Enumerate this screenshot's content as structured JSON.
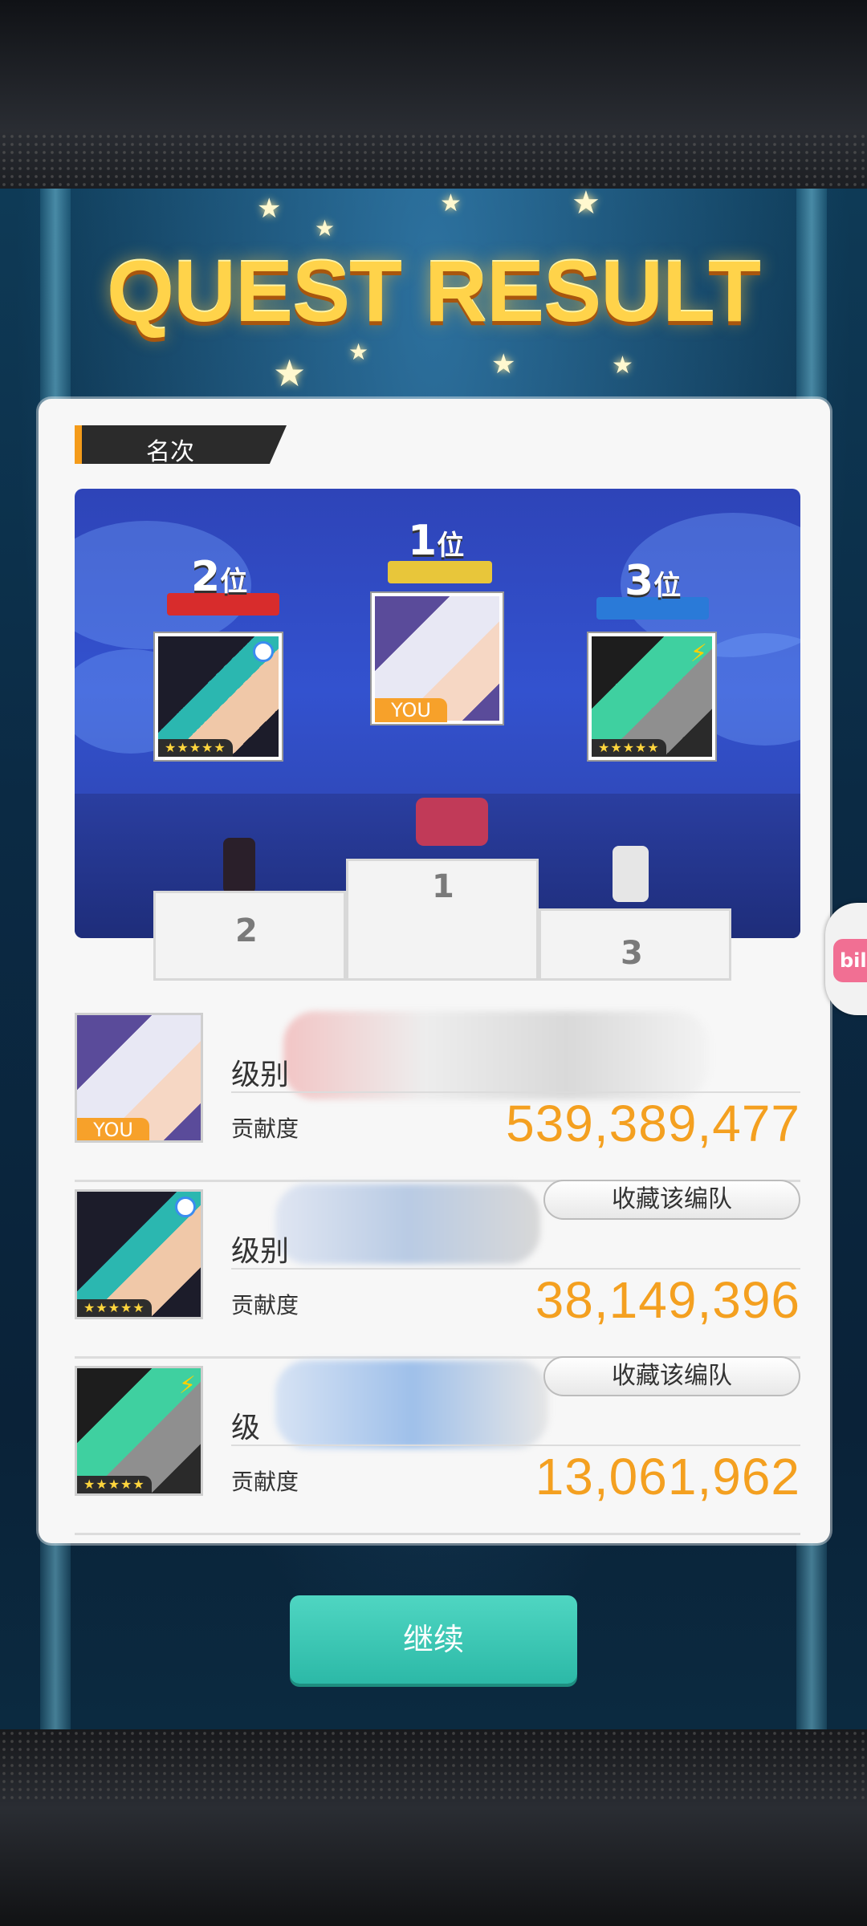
{
  "title": "QUEST RESULT",
  "section_tag": "名次",
  "podium": {
    "first": {
      "rank": "1",
      "suffix": "位",
      "you_tag": "YOU"
    },
    "second": {
      "rank": "2",
      "suffix": "位",
      "stars": "★★★★★"
    },
    "third": {
      "rank": "3",
      "suffix": "位",
      "stars": "★★★★★"
    },
    "pedestal_labels": [
      "1",
      "2",
      "3"
    ]
  },
  "results": [
    {
      "level_label": "级别",
      "contrib_label": "贡献度",
      "contrib_value": "539,389,477",
      "you_tag": "YOU"
    },
    {
      "level_label": "级别",
      "contrib_label": "贡献度",
      "contrib_value": "38,149,396",
      "save_button": "收藏该编队",
      "stars": "★★★★★"
    },
    {
      "level_label": "级",
      "contrib_label": "贡献度",
      "contrib_value": "13,061,962",
      "save_button": "收藏该编队",
      "stars": "★★★★★"
    }
  ],
  "continue_button": "继续",
  "side_float_label": "bili",
  "colors": {
    "accent_orange": "#f4a020",
    "continue_teal": "#2cb9a7",
    "title_gold": "#ffd34a"
  }
}
